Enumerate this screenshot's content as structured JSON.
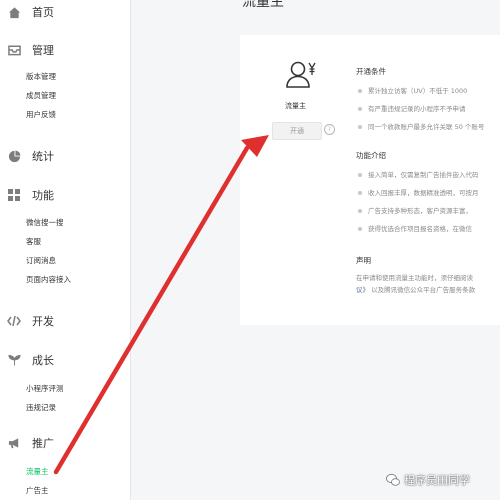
{
  "sidebar": {
    "home": {
      "label": "首页",
      "icon": "home-icon"
    },
    "manage": {
      "label": "管理",
      "icon": "inbox-icon",
      "items": [
        "版本管理",
        "成员管理",
        "用户反馈"
      ]
    },
    "stats": {
      "label": "统计",
      "icon": "pie-chart-icon"
    },
    "features": {
      "label": "功能",
      "icon": "grid-icon",
      "items": [
        "微信搜一搜",
        "客服",
        "订阅消息",
        "页面内容接入"
      ]
    },
    "dev": {
      "label": "开发",
      "icon": "code-icon"
    },
    "growth": {
      "label": "成长",
      "icon": "sprout-icon",
      "items": [
        "小程序评测",
        "违规记录"
      ]
    },
    "promote": {
      "label": "推广",
      "icon": "megaphone-icon",
      "items": [
        "流量主",
        "广告主"
      ],
      "active_item": "流量主"
    }
  },
  "main": {
    "title": "流量主",
    "role_label": "流量主",
    "open_button": "开通",
    "conditions": {
      "title": "开通条件",
      "items": [
        "累计独立访客（UV）不低于 1000",
        "有严重违规记录的小程序不予申请",
        "同一个收款账户最多允许关联 50 个账号"
      ]
    },
    "intro": {
      "title": "功能介绍",
      "items": [
        "接入简单，仅需复制广告插件嵌入代码",
        "收入回报丰厚，数据精准透明，可按月",
        "广告支持多种形态，客户资源丰富，",
        "获得优选合作项目报名资格，在微信"
      ]
    },
    "declaration": {
      "title": "声明",
      "line1": "在申请和使用流量主功能时，须仔细阅读",
      "line2_link": "议》",
      "line2_rest": "以及腾讯微信公众平台广告服务条款"
    }
  },
  "watermark": {
    "text": "程序员田同学",
    "icon": "wechat-icon"
  },
  "colors": {
    "active": "#07c160",
    "annotation_arrow": "#e02f2f",
    "link": "#576b95"
  },
  "annotation": {
    "type": "red arrow pointing from 流量主 menu item to 开通 button"
  }
}
